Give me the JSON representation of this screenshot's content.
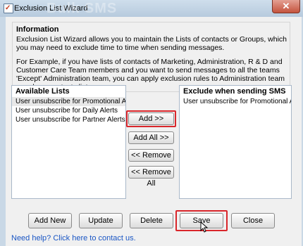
{
  "window": {
    "title": "Exclusion List Wizard",
    "background_title": "Bulk SMS",
    "close_glyph": "✕"
  },
  "info": {
    "heading": "Information",
    "paragraph1": "Exclusion List Wizard allows you to maintain the Lists of contacts or Groups, which you may need to exclude time to time when sending messages.",
    "paragraph2": "For Example, if you have lists of contacts of Marketing, Administration, R & D and Customer Care Team members and you want to send messages to all the teams 'Except' Administration team, you can apply exclusion rules to Administration team members contacts list."
  },
  "available_lists": {
    "header": "Available Lists",
    "items": [
      "User unsubscribe for Promotional A...",
      "User unsubscribe for Daily Alerts",
      "User unsubscribe for Partner Alerts"
    ],
    "selected_index": 0
  },
  "exclude_lists": {
    "header": "Exclude when sending SMS",
    "items": [
      "User unsubscribe for Promotional A..."
    ]
  },
  "middle_buttons": {
    "add": "Add >>",
    "add_all": "Add All >>",
    "remove": "<< Remove",
    "remove_all": "<< Remove All"
  },
  "bottom_buttons": {
    "add_new": "Add New",
    "update": "Update",
    "delete": "Delete",
    "save": "Save",
    "close": "Close"
  },
  "help_link": "Need help? Click here to contact us.",
  "colors": {
    "highlight": "#d9262b",
    "link": "#1a56c4",
    "close_button": "#c4533d"
  },
  "icons": {
    "app": "exclusion-wizard-app-icon",
    "close": "close-icon",
    "cursor": "mouse-pointer-icon"
  }
}
